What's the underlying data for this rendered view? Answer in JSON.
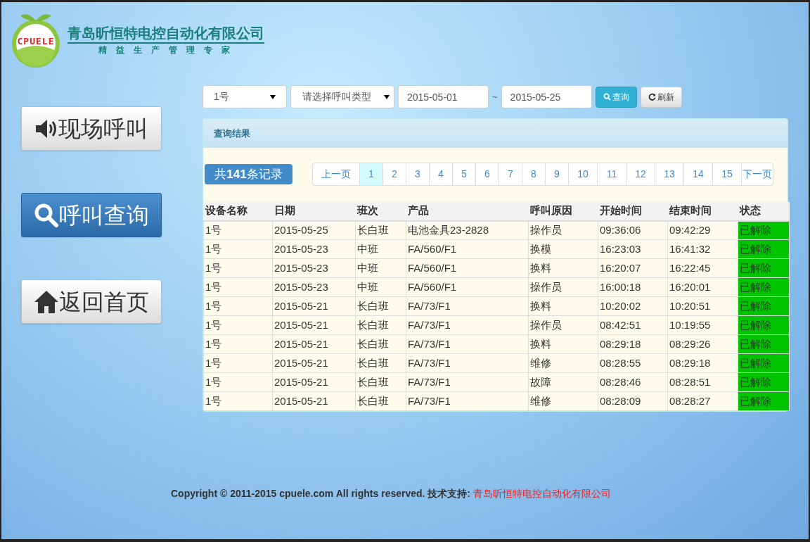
{
  "header": {
    "logo_text": "CPUELE",
    "company": "青岛昕恒特电控自动化有限公司",
    "slogan": "精益生产管理专家"
  },
  "sidebar": {
    "items": [
      {
        "label": "现场呼叫",
        "kind": "speaker",
        "selected": false
      },
      {
        "label": "呼叫查询",
        "kind": "search",
        "selected": true
      },
      {
        "label": "返回首页",
        "kind": "home",
        "selected": false
      }
    ]
  },
  "filters": {
    "device": "1号",
    "call_type": "请选择呼叫类型",
    "date_from": "2015-05-01",
    "separator": "~",
    "date_to": "2015-05-25",
    "query_button": "查询",
    "refresh_button": "刷新"
  },
  "results": {
    "title": "查询结果",
    "total": "共**141**条记录",
    "pagination": {
      "prev": "上一页",
      "next": "下一页",
      "pages": [
        {
          "label": "1",
          "selected": true
        },
        {
          "label": "2",
          "selected": false
        },
        {
          "label": "3",
          "selected": false
        },
        {
          "label": "4",
          "selected": false
        },
        {
          "label": "5",
          "selected": false
        },
        {
          "label": "6",
          "selected": false
        },
        {
          "label": "7",
          "selected": false
        },
        {
          "label": "8",
          "selected": false
        },
        {
          "label": "9",
          "selected": false
        },
        {
          "label": "10",
          "selected": false
        },
        {
          "label": "11",
          "selected": false
        },
        {
          "label": "12",
          "selected": false
        },
        {
          "label": "13",
          "selected": false
        },
        {
          "label": "14",
          "selected": false
        },
        {
          "label": "15",
          "selected": false
        }
      ]
    },
    "table": {
      "columns": [
        "设备名称",
        "日期",
        "班次",
        "产品",
        "呼叫原因",
        "开始时间",
        "结束时间",
        "状态"
      ],
      "rows": [
        {
          "cells": [
            "1号",
            "2015-05-25",
            "长白班",
            "电池金具23-2828",
            "操作员",
            "09:36:06",
            "09:42:29",
            "已解除"
          ],
          "color": "#00c400"
        },
        {
          "cells": [
            "1号",
            "2015-05-23",
            "中班",
            "FA/560/F1",
            "换模",
            "16:23:03",
            "16:41:32",
            "已解除"
          ],
          "color": "#00c400"
        },
        {
          "cells": [
            "1号",
            "2015-05-23",
            "中班",
            "FA/560/F1",
            "换料",
            "16:20:07",
            "16:22:45",
            "已解除"
          ],
          "color": "#00c400"
        },
        {
          "cells": [
            "1号",
            "2015-05-23",
            "中班",
            "FA/560/F1",
            "操作员",
            "16:00:18",
            "16:20:01",
            "已解除"
          ],
          "color": "#00c400"
        },
        {
          "cells": [
            "1号",
            "2015-05-21",
            "长白班",
            "FA/73/F1",
            "换料",
            "10:20:02",
            "10:20:51",
            "已解除"
          ],
          "color": "#00c400"
        },
        {
          "cells": [
            "1号",
            "2015-05-21",
            "长白班",
            "FA/73/F1",
            "操作员",
            "08:42:51",
            "10:19:55",
            "已解除"
          ],
          "color": "#00c400"
        },
        {
          "cells": [
            "1号",
            "2015-05-21",
            "长白班",
            "FA/73/F1",
            "换料",
            "08:29:18",
            "08:29:26",
            "已解除"
          ],
          "color": "#00c400"
        },
        {
          "cells": [
            "1号",
            "2015-05-21",
            "长白班",
            "FA/73/F1",
            "维修",
            "08:28:55",
            "08:29:18",
            "已解除"
          ],
          "color": "#00c400"
        },
        {
          "cells": [
            "1号",
            "2015-05-21",
            "长白班",
            "FA/73/F1",
            "故障",
            "08:28:46",
            "08:28:51",
            "已解除"
          ],
          "color": "#00c400"
        },
        {
          "cells": [
            "1号",
            "2015-05-21",
            "长白班",
            "FA/73/F1",
            "维修",
            "08:28:09",
            "08:28:27",
            "已解除"
          ],
          "color": "#00c400"
        }
      ]
    }
  },
  "footer": {
    "copyright": "Copyright © 2011-2015 cpuele.com All rights reserved. 技术支持:",
    "link": "青岛昕恒特电控自动化有限公司"
  }
}
